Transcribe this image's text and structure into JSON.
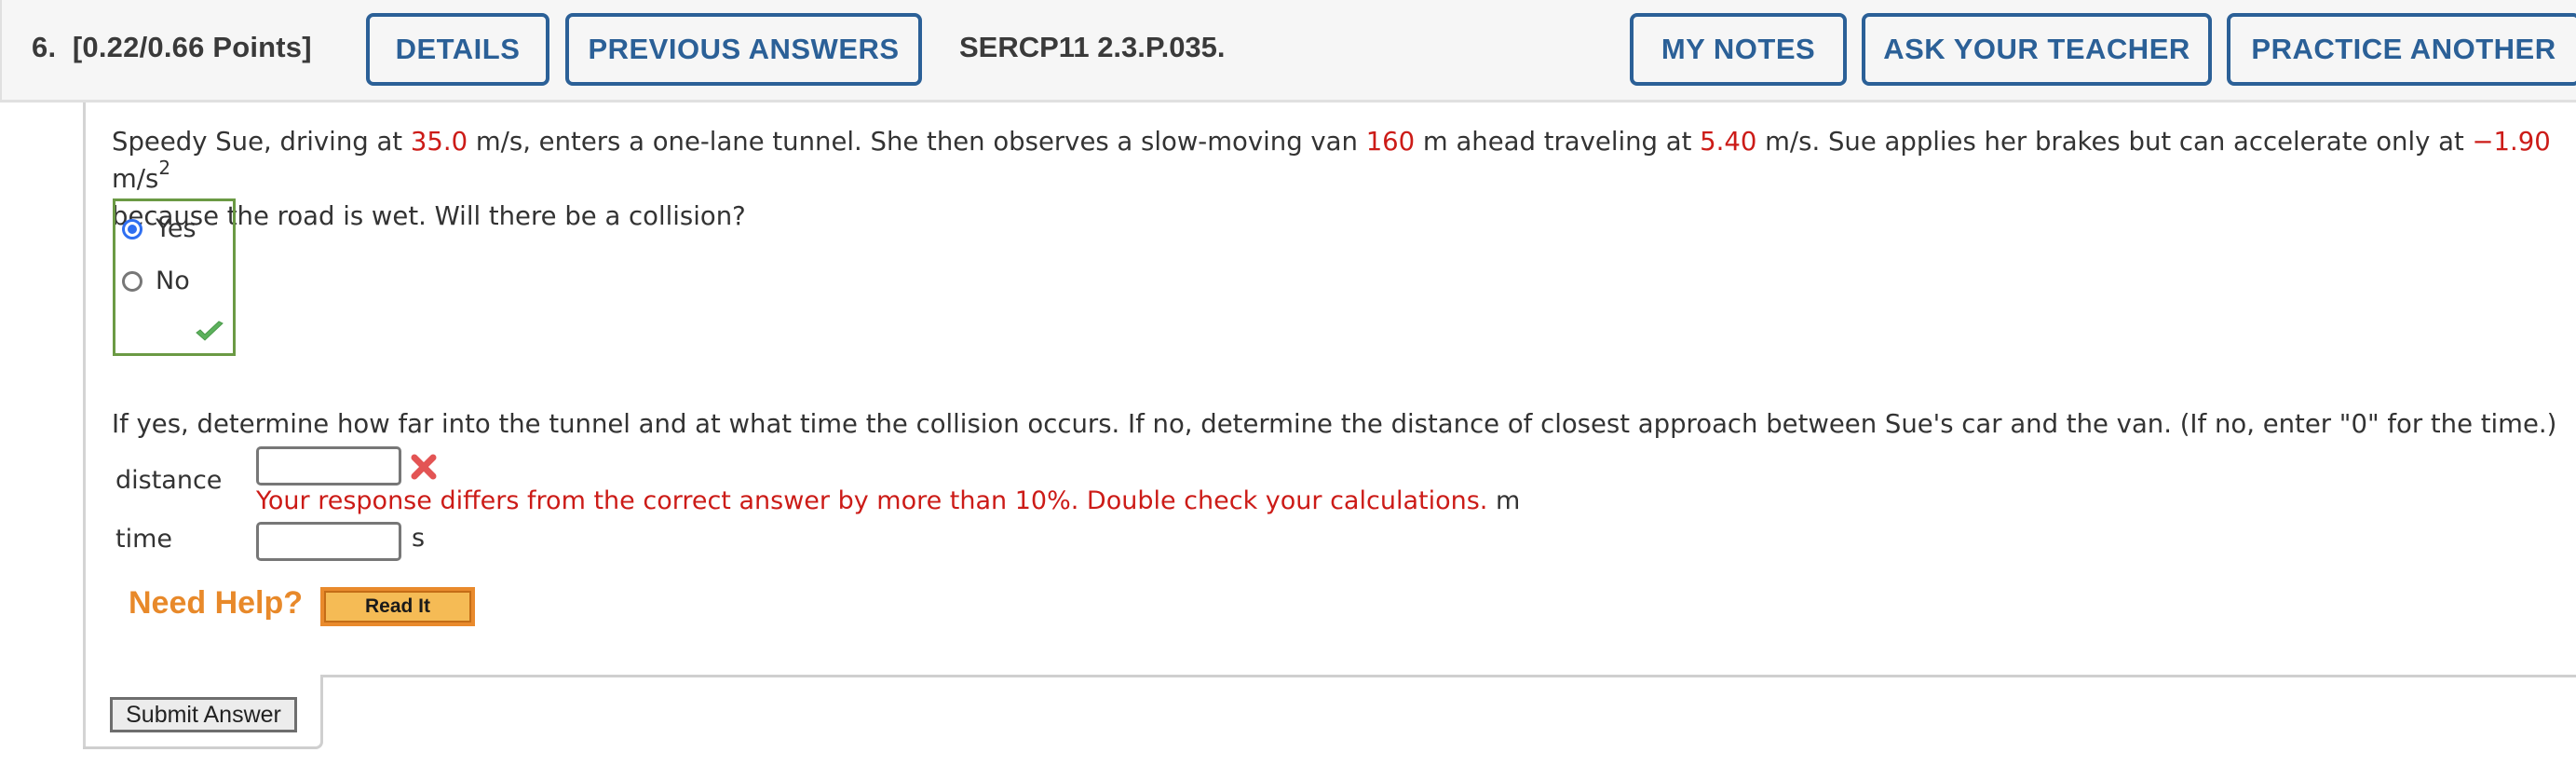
{
  "header": {
    "question_number": "6.",
    "points": "[0.22/0.66 Points]",
    "details_label": "DETAILS",
    "previous_answers_label": "PREVIOUS ANSWERS",
    "problem_code": "SERCP11 2.3.P.035.",
    "my_notes_label": "MY NOTES",
    "ask_teacher_label": "ASK YOUR TEACHER",
    "practice_another_label": "PRACTICE ANOTHER"
  },
  "question": {
    "t1": "Speedy Sue, driving at ",
    "v_sue": "35.0",
    "t2": " m/s, enters a one-lane tunnel. She then observes a slow-moving van ",
    "v_dist": "160",
    "t3": " m ahead traveling at ",
    "v_van": "5.40",
    "t4": " m/s. Sue applies her brakes but can accelerate only at ",
    "v_acc": "−1.90",
    "t5": " m/s",
    "exp": "2",
    "t6": "because the road is wet. Will there be a collision?"
  },
  "choices": {
    "options": [
      {
        "label": "Yes",
        "selected": true
      },
      {
        "label": "No",
        "selected": false
      }
    ],
    "status_icon": "checkmark-icon",
    "status": "correct"
  },
  "part2": {
    "prompt": "If yes, determine how far into the tunnel and at what time the collision occurs. If no, determine the distance of closest approach between Sue's car and the van. (If no, enter \"0\" for the time.)",
    "distance": {
      "label": "distance",
      "value": "",
      "unit": "m",
      "status_icon": "x-mark-icon",
      "error": "Your response differs from the correct answer by more than 10%. Double check your calculations."
    },
    "time": {
      "label": "time",
      "value": "",
      "unit": "s"
    }
  },
  "help": {
    "need_help_label": "Need Help?",
    "read_it_label": "Read It"
  },
  "submit_label": "Submit Answer",
  "colors": {
    "accent_blue": "#2b6097",
    "value_red": "#cc1b17",
    "correct_green": "#6b9a44",
    "help_orange": "#e8892a"
  }
}
